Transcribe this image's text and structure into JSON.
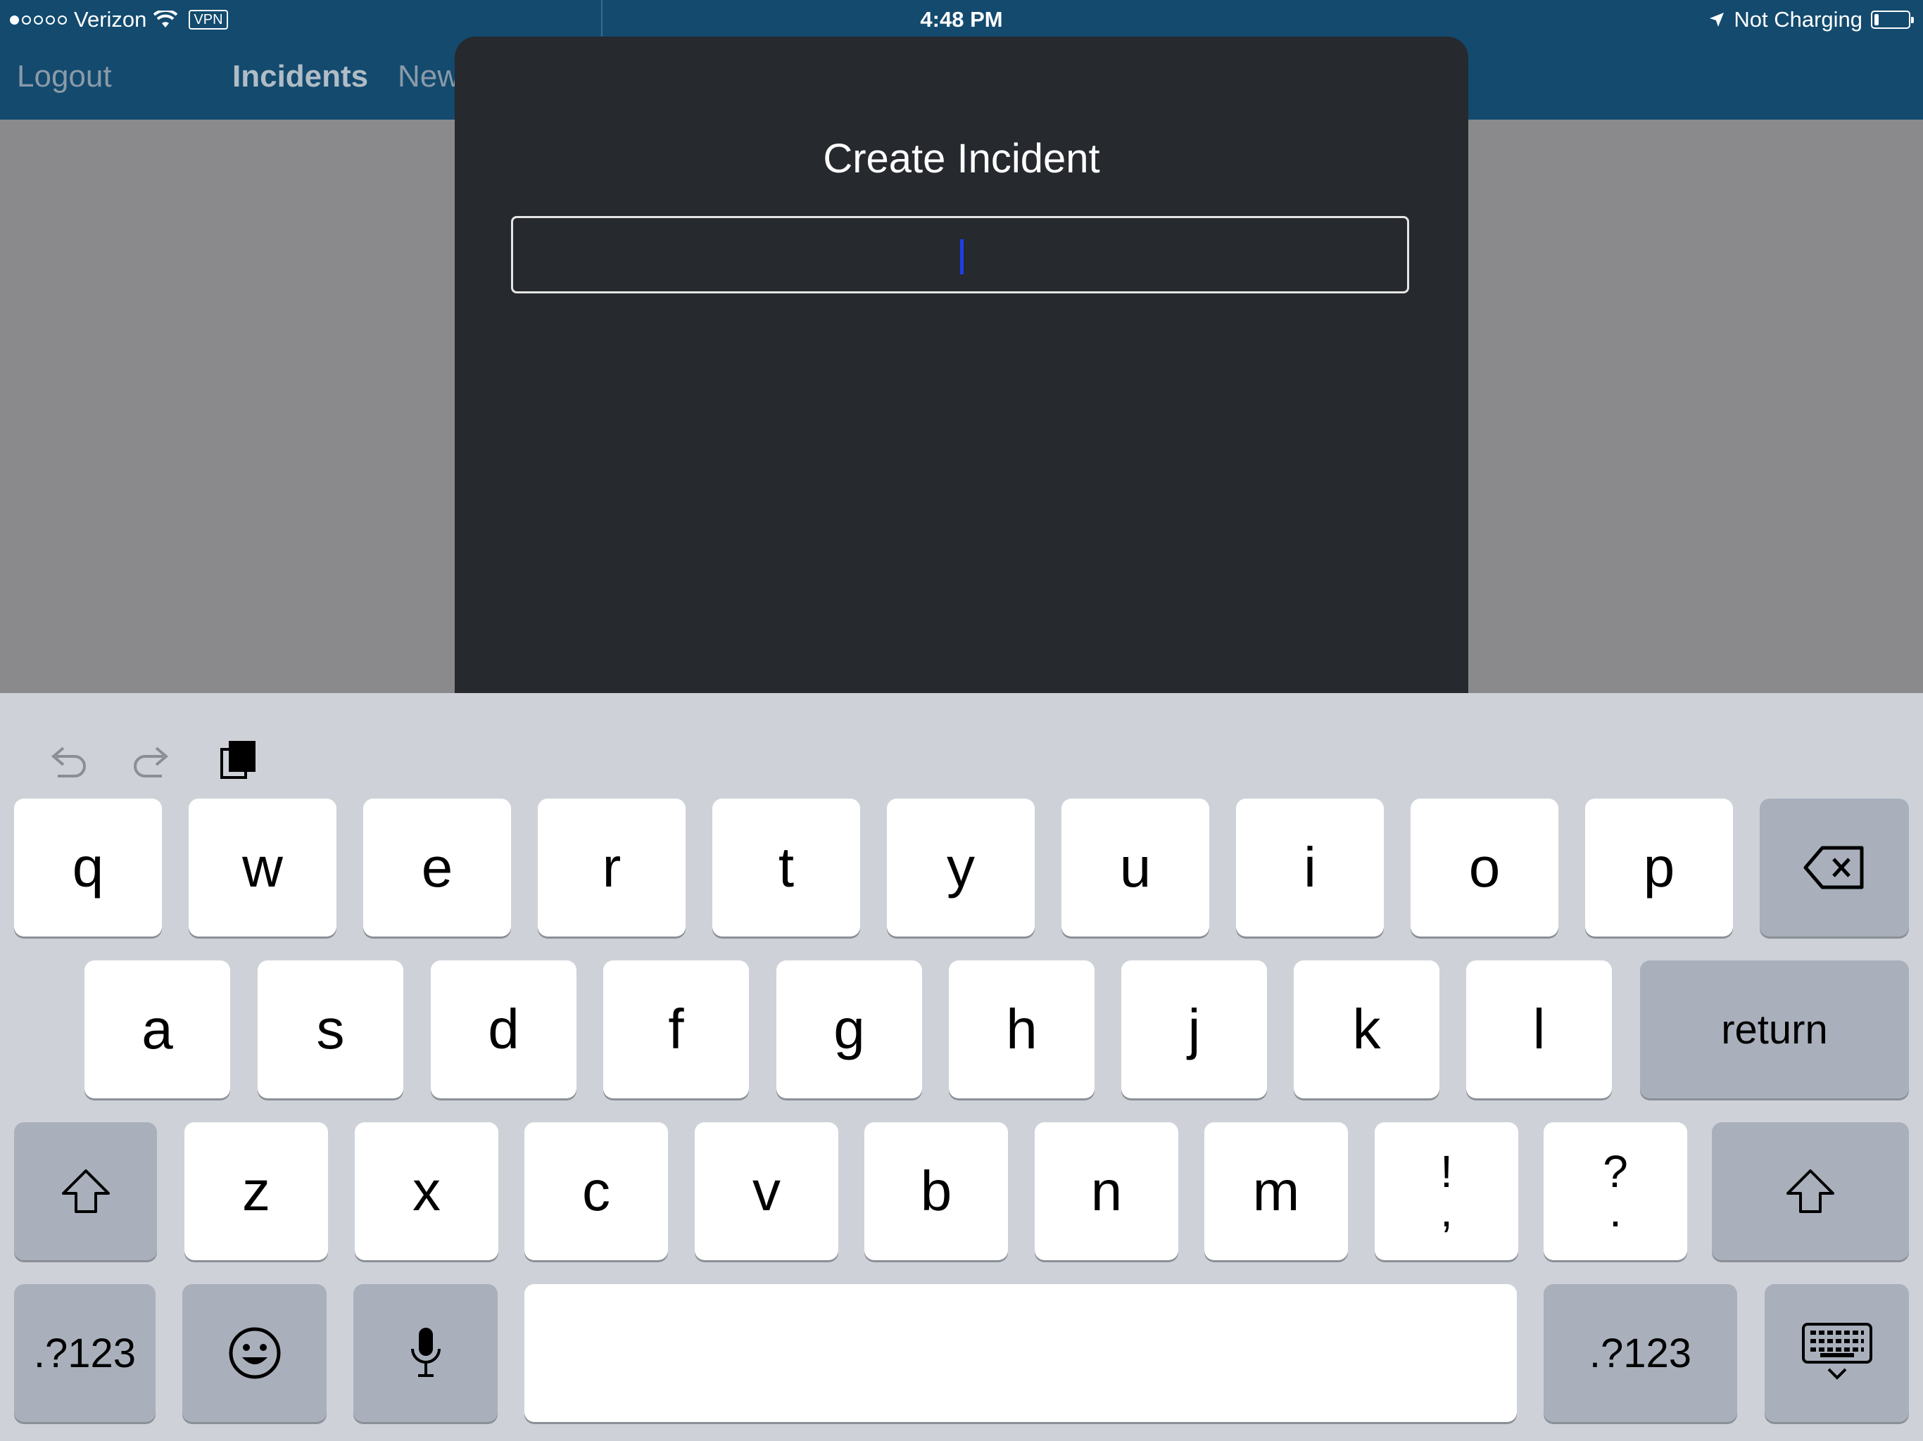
{
  "status_bar": {
    "carrier": "Verizon",
    "vpn": "VPN",
    "time": "4:48 PM",
    "battery_status": "Not Charging",
    "battery_level": 0.12
  },
  "nav": {
    "logout": "Logout",
    "incidents": "Incidents",
    "new": "New"
  },
  "modal": {
    "title": "Create Incident",
    "input_value": ""
  },
  "keyboard": {
    "row1": [
      "q",
      "w",
      "e",
      "r",
      "t",
      "y",
      "u",
      "i",
      "o",
      "p"
    ],
    "row2": [
      "a",
      "s",
      "d",
      "f",
      "g",
      "h",
      "j",
      "k",
      "l"
    ],
    "row3": [
      "z",
      "x",
      "c",
      "v",
      "b",
      "n",
      "m"
    ],
    "punct1_top": "!",
    "punct1_bottom": ",",
    "punct2_top": "?",
    "punct2_bottom": ".",
    "return_label": "return",
    "numbers_left": ".?123",
    "numbers_right": ".?123",
    "icons": [
      "undo-icon",
      "redo-icon",
      "clipboard-icon",
      "backspace-icon",
      "shift-icon",
      "emoji-icon",
      "microphone-icon",
      "hide-keyboard-icon"
    ]
  }
}
